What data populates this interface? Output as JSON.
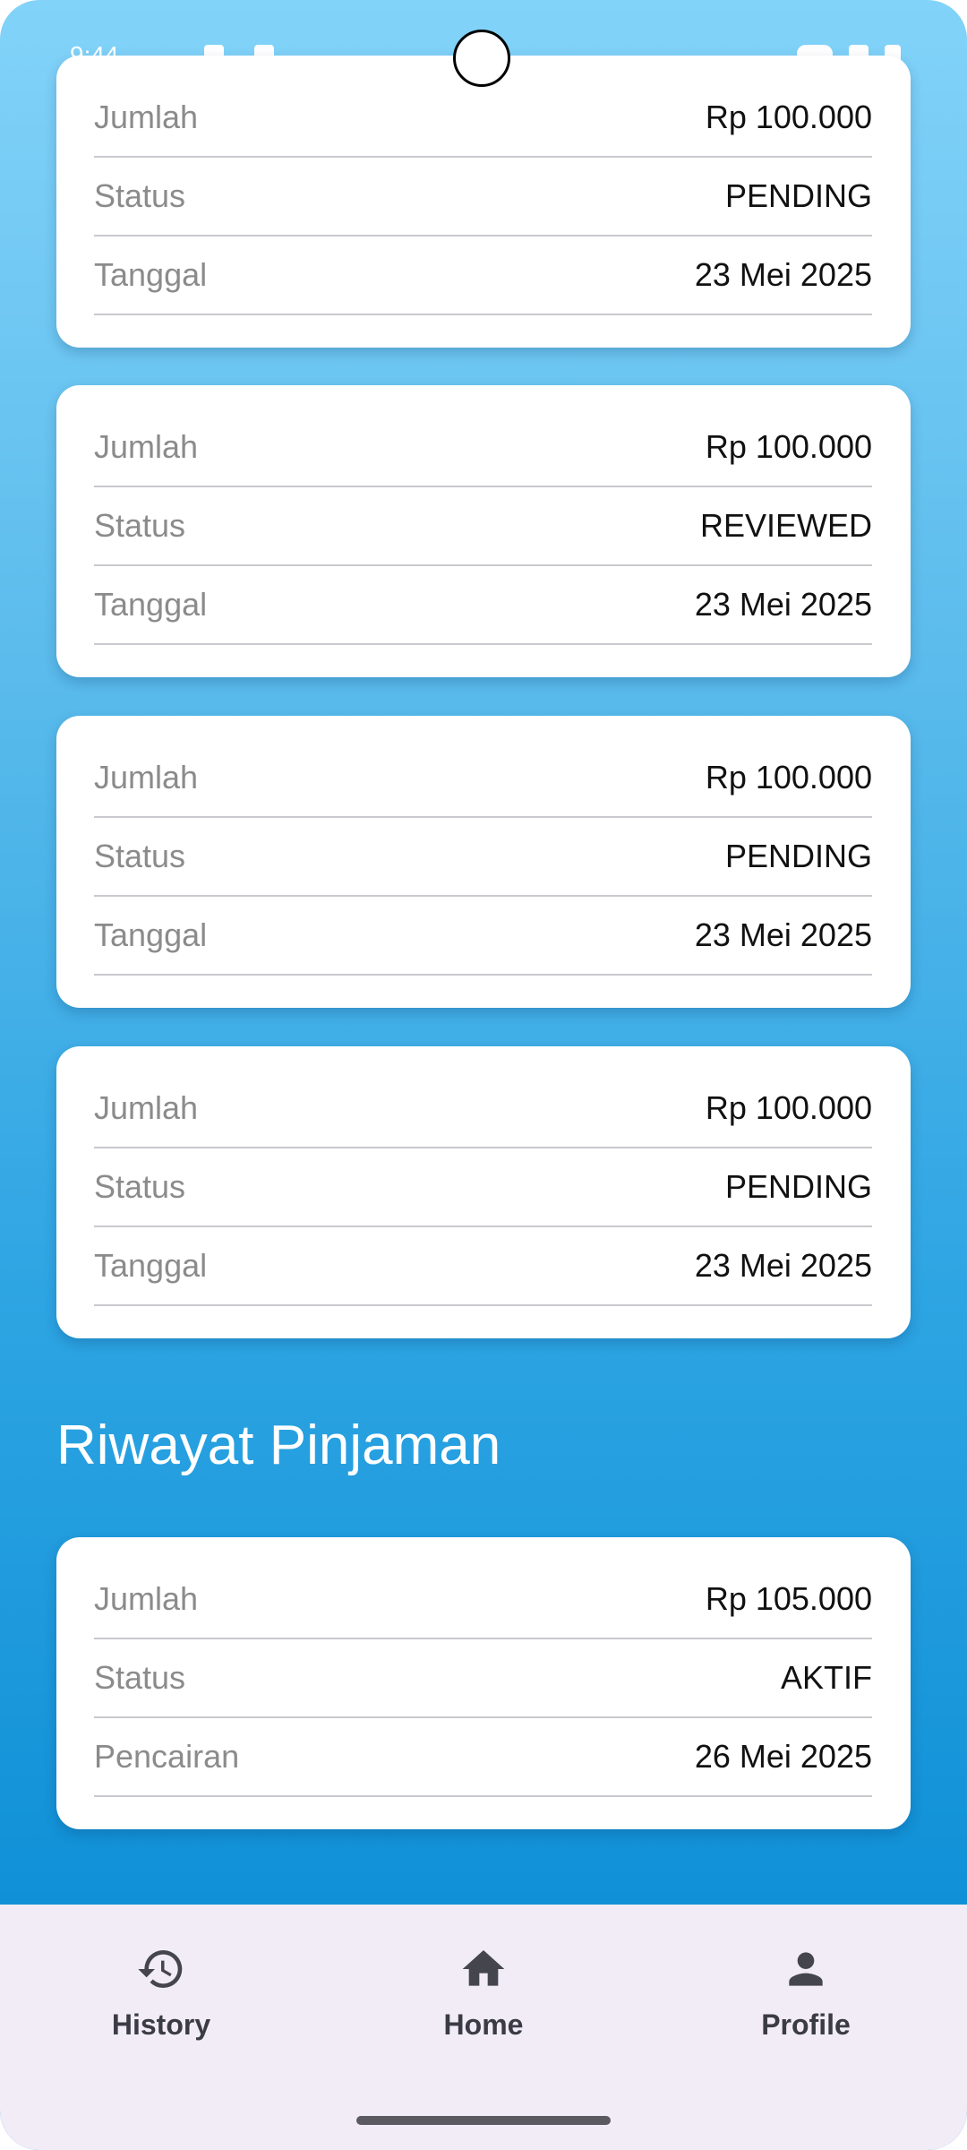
{
  "status_bar": {
    "time": "9:44"
  },
  "cards": [
    {
      "rows": [
        {
          "label": "Jumlah",
          "value": "Rp 100.000"
        },
        {
          "label": "Status",
          "value": "PENDING"
        },
        {
          "label": "Tanggal",
          "value": "23 Mei 2025"
        }
      ]
    },
    {
      "rows": [
        {
          "label": "Jumlah",
          "value": "Rp 100.000"
        },
        {
          "label": "Status",
          "value": "REVIEWED"
        },
        {
          "label": "Tanggal",
          "value": "23 Mei 2025"
        }
      ]
    },
    {
      "rows": [
        {
          "label": "Jumlah",
          "value": "Rp 100.000"
        },
        {
          "label": "Status",
          "value": "PENDING"
        },
        {
          "label": "Tanggal",
          "value": "23 Mei 2025"
        }
      ]
    },
    {
      "rows": [
        {
          "label": "Jumlah",
          "value": "Rp 100.000"
        },
        {
          "label": "Status",
          "value": "PENDING"
        },
        {
          "label": "Tanggal",
          "value": "23 Mei 2025"
        }
      ]
    }
  ],
  "loan_history": {
    "title": "Riwayat Pinjaman",
    "cards": [
      {
        "rows": [
          {
            "label": "Jumlah",
            "value": "Rp 105.000"
          },
          {
            "label": "Status",
            "value": "AKTIF"
          },
          {
            "label": "Pencairan",
            "value": "26 Mei 2025"
          }
        ]
      }
    ]
  },
  "bottom_nav": {
    "items": [
      {
        "label": "History",
        "icon": "history-icon"
      },
      {
        "label": "Home",
        "icon": "home-icon"
      },
      {
        "label": "Profile",
        "icon": "person-icon"
      }
    ]
  },
  "colors": {
    "gradient_top": "#82d3f9",
    "gradient_bottom": "#0488d2",
    "nav_background": "#f1ecf6",
    "card_background": "#ffffff"
  }
}
